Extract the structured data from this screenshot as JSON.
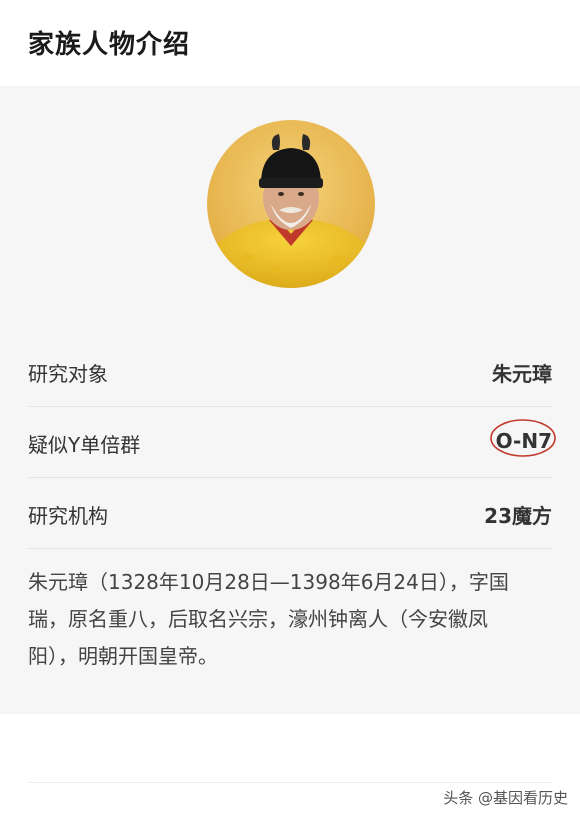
{
  "header": {
    "title": "家族人物介绍"
  },
  "profile": {
    "avatar_icon": "emperor-portrait",
    "rows": [
      {
        "label": "研究对象",
        "value": "朱元璋"
      },
      {
        "label": "疑似Y单倍群",
        "value": "O-N7"
      },
      {
        "label": "研究机构",
        "value": "23魔方"
      }
    ],
    "description": "朱元璋（1328年10月28日—1398年6月24日），字国瑞，原名重八，后取名兴宗，濠州钟离人（今安徽凤阳），明朝开国皇帝。"
  },
  "annotation_color": "#c0392b",
  "watermark": "头条 @基因看历史"
}
